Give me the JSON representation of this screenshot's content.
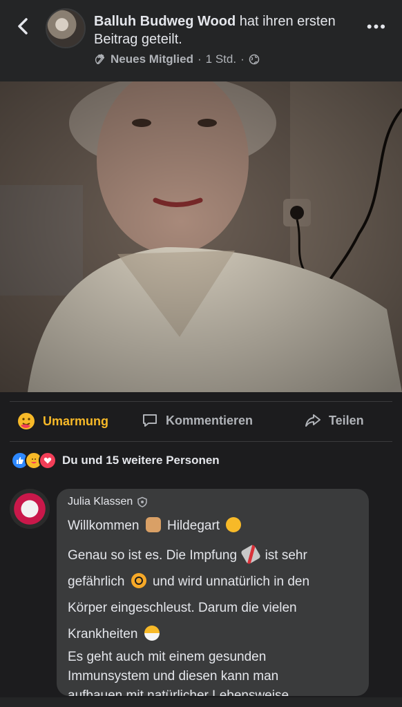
{
  "header": {
    "author": "Balluh Budweg Wood",
    "action_text": "hat ihren ersten Beitrag geteilt.",
    "badge": "Neues Mitglied",
    "time": "1 Std.",
    "separator": "·"
  },
  "actions": {
    "reaction_label": "Umarmung",
    "comment_label": "Kommentieren",
    "share_label": "Teilen"
  },
  "reactions_summary": "Du und 15 weitere Personen",
  "comment": {
    "author": "Julia Klassen",
    "line1a": "Willkommen",
    "line1b": "Hildegart",
    "line2a": "Genau so ist es. Die Impfung",
    "line2b": "ist sehr",
    "line3a": "gefährlich",
    "line3b": "und wird unnatürlich in den",
    "line4": "Körper eingeschleust. Darum die vielen",
    "line5": "Krankheiten",
    "line6": "Es geht auch mit einem gesunden",
    "line7": "Immunsystem und diesen kann man",
    "line8": "aufbauen mit natürlicher Lebensweise"
  },
  "icons": [
    "back-chevron-icon",
    "more-icon",
    "wave-icon",
    "globe-icon",
    "hug-icon",
    "comment-icon",
    "share-icon",
    "like-icon",
    "heart-icon",
    "pray-emoji",
    "hug-emoji",
    "syringe-emoji",
    "biohazard-emoji",
    "mask-emoji",
    "shield-icon"
  ],
  "colors": {
    "accent_hug": "#f7b928",
    "like_blue": "#2d88ff",
    "heart_red": "#f33e58"
  }
}
